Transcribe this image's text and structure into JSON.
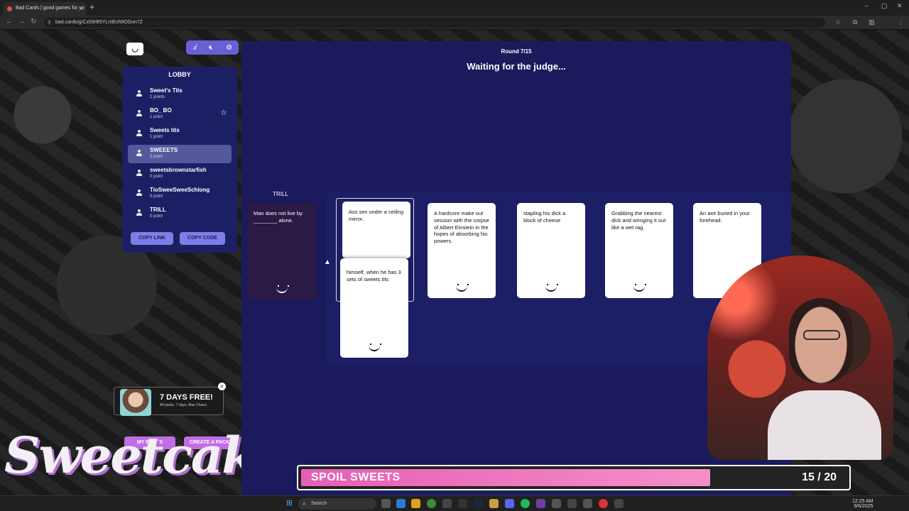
{
  "browser": {
    "tab_title": "Bad Cards | good games for yo",
    "url": "bad.cards/g/Cx59rB5YLmEch9OGon7Z"
  },
  "lobby": {
    "title": "LOBBY",
    "players": [
      {
        "name": "Sweet's Tits",
        "points": "2 points"
      },
      {
        "name": "BO_ BO",
        "points": "1 point"
      },
      {
        "name": "Sweets tits",
        "points": "1 point"
      },
      {
        "name": "SWEEETS",
        "points": "0 point"
      },
      {
        "name": "sweetsbrownstarfish",
        "points": "0 point"
      },
      {
        "name": "TioSweeSweeSchlong",
        "points": "0 point"
      },
      {
        "name": "TRILL",
        "points": "0 point"
      }
    ],
    "copy_link": "COPY LINK",
    "copy_code": "COPY CODE"
  },
  "promo": {
    "title": "7 DAYS FREE!",
    "subtitle": "All packs. 7 days. Max Chaos.",
    "close": "×"
  },
  "packs": {
    "my_packs": "MY PACKS",
    "create_pack": "CREATE A PACK"
  },
  "brand": "Sweetcakes",
  "game": {
    "round": "Round 7/15",
    "status": "Waiting for the judge...",
    "judge_name": "TRILL",
    "black_card": "Man does not live by ________ alone.",
    "white_cards": [
      "Ass sex under a ceiling mirror.",
      "himself, when he has 3 sets of sweets tits",
      "A hardcore make out session with the corpse of Albert Einstein in the hopes of absorbing his powers.",
      "stapling his dick a block of cheese",
      "Grabbing the nearest dick and wringing it out like a wet rag.",
      "An axe buried in your forehead."
    ]
  },
  "goal": {
    "label": "SPOIL SWEETS",
    "count": "15 / 20",
    "progress": 0.75
  },
  "taskbar": {
    "search": "Search",
    "time": "12:25 AM",
    "date": "9/6/2025"
  },
  "icons": [
    "logo-icon",
    "no-music-icon",
    "mute-icon",
    "settings-icon",
    "user-icon",
    "star-icon",
    "smile-icon",
    "windows-icon"
  ]
}
